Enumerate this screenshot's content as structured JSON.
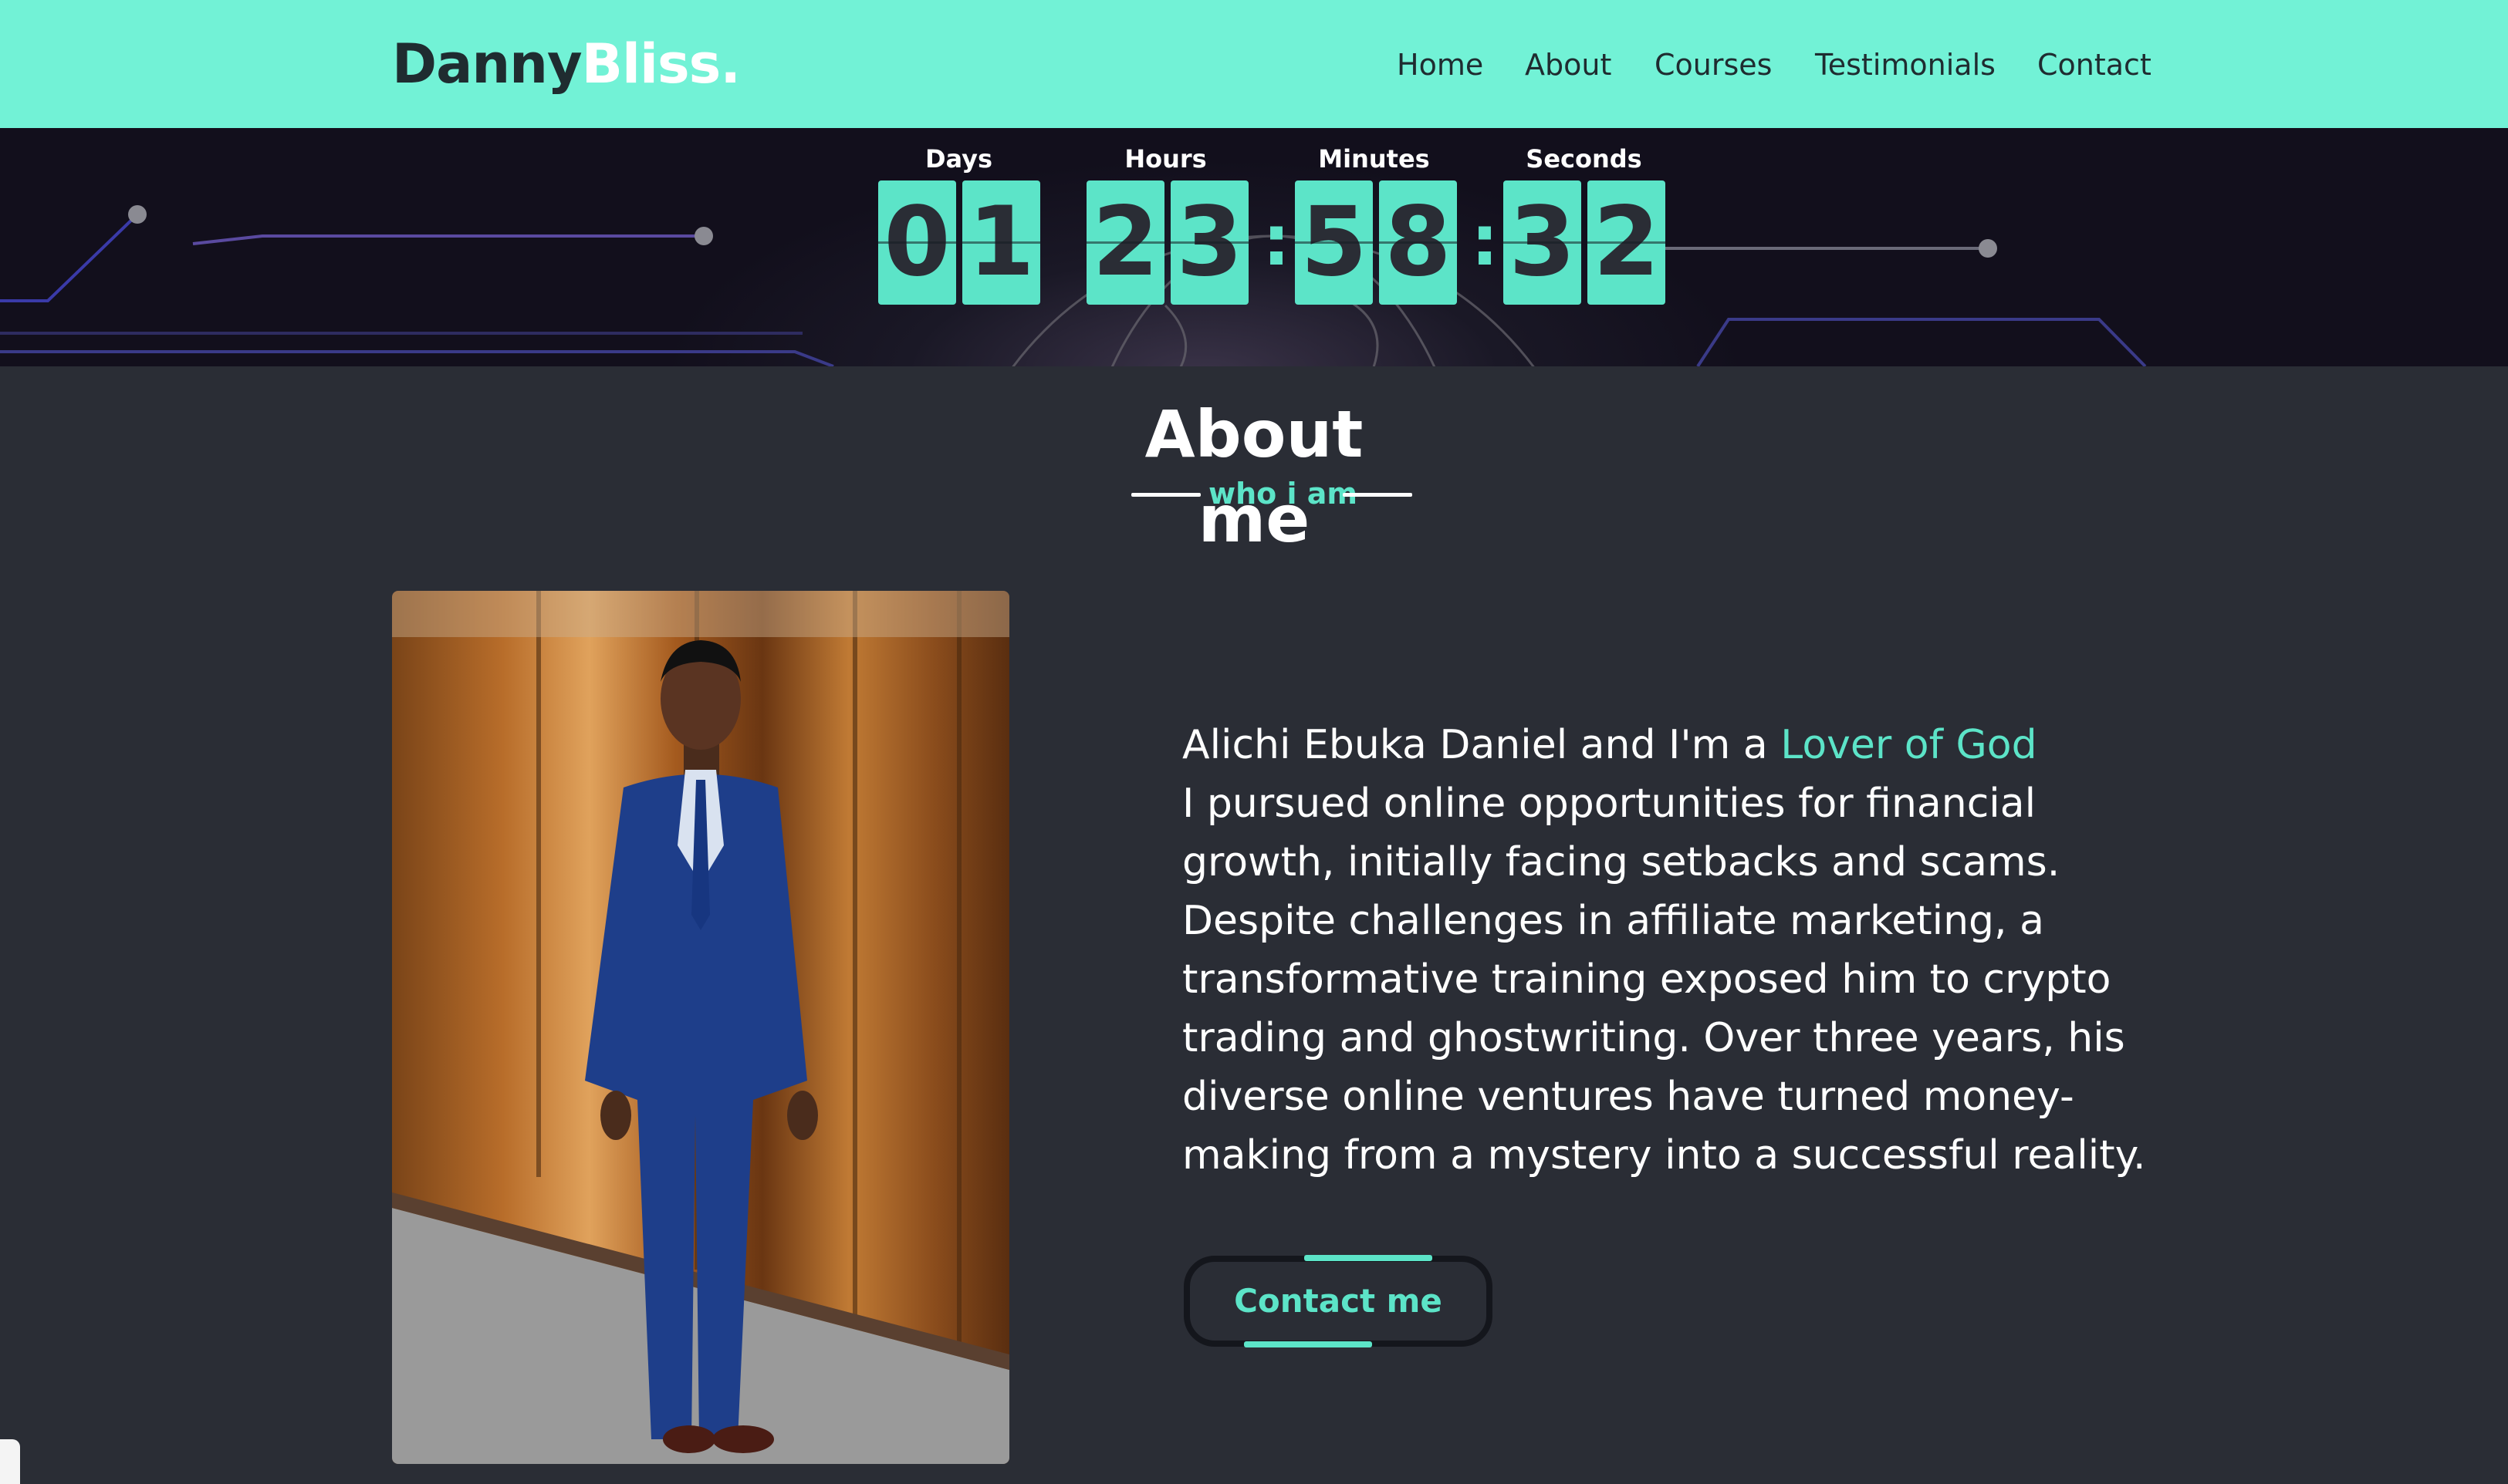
{
  "header": {
    "logo_part1": "Danny",
    "logo_part2": "Bliss.",
    "nav": [
      "Home",
      "About",
      "Courses",
      "Testimonials",
      "Contact"
    ]
  },
  "countdown": {
    "labels": {
      "days": "Days",
      "hours": "Hours",
      "minutes": "Minutes",
      "seconds": "Seconds"
    },
    "days": [
      "0",
      "1"
    ],
    "hours": [
      "2",
      "3"
    ],
    "minutes": [
      "5",
      "8"
    ],
    "seconds": [
      "3",
      "2"
    ],
    "separator": ":"
  },
  "about": {
    "title": "About me",
    "subtitle": "who i am",
    "intro": "Alichi Ebuka Daniel and I'm a ",
    "intro_accent": "Lover of God",
    "body": "I pursued online opportunities for financial growth, initially facing setbacks and scams. Despite challenges in affiliate marketing, a transformative training exposed him to crypto trading and ghostwriting. Over three years, his diverse online ventures have turned money-making from a mystery into a successful reality.",
    "button": "Contact me"
  },
  "colors": {
    "accent": "#5ce4c8",
    "header_bg": "#72f2d6",
    "page_bg": "#2a2d35"
  }
}
